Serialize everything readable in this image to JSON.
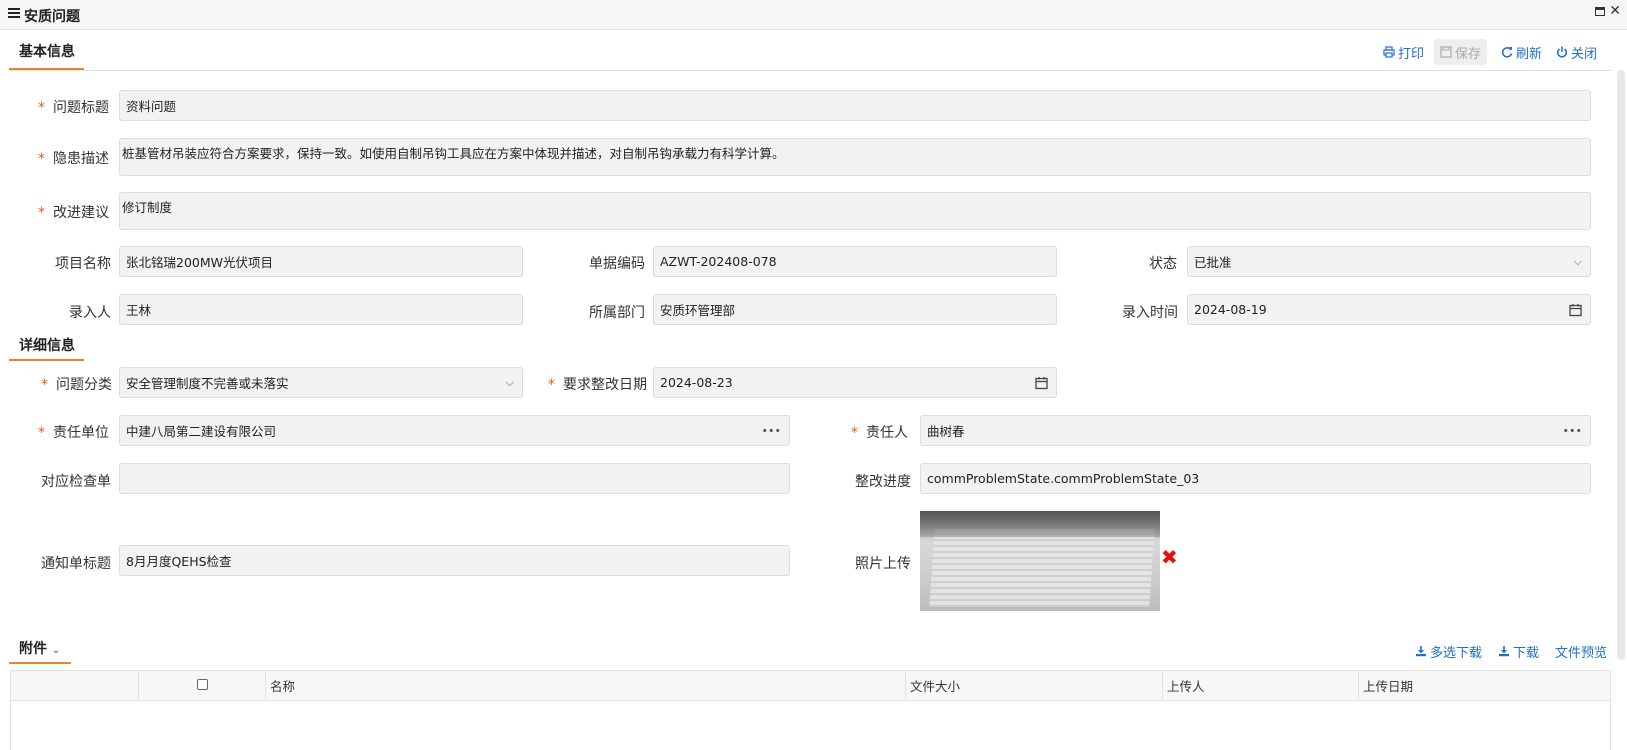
{
  "window": {
    "title": "安质问题"
  },
  "toolbar": {
    "print": "打印",
    "save": "保存",
    "refresh": "刷新",
    "close": "关闭"
  },
  "sections": {
    "basic": "基本信息",
    "detail": "详细信息",
    "attachments": "附件"
  },
  "basic": {
    "issue_title": {
      "label": "问题标题",
      "value": "资料问题"
    },
    "hazard_desc": {
      "label": "隐患描述",
      "value": "桩基管材吊装应符合方案要求，保持一致。如使用自制吊钩工具应在方案中体现并描述，对自制吊钩承载力有科学计算。"
    },
    "suggestion": {
      "label": "改进建议",
      "value": "修订制度"
    },
    "project": {
      "label": "项目名称",
      "value": "张北铭瑞200MW光伏项目"
    },
    "doc_code": {
      "label": "单据编码",
      "value": "AZWT-202408-078"
    },
    "status": {
      "label": "状态",
      "value": "已批准"
    },
    "entered_by": {
      "label": "录入人",
      "value": "王林"
    },
    "department": {
      "label": "所属部门",
      "value": "安质环管理部"
    },
    "entered_time": {
      "label": "录入时间",
      "value": "2024-08-19"
    }
  },
  "detail": {
    "category": {
      "label": "问题分类",
      "value": "安全管理制度不完善或未落实"
    },
    "deadline": {
      "label": "要求整改日期",
      "value": "2024-08-23"
    },
    "resp_unit": {
      "label": "责任单位",
      "value": "中建八局第二建设有限公司"
    },
    "resp_person": {
      "label": "责任人",
      "value": "曲树春"
    },
    "checklist": {
      "label": "对应检查单",
      "value": ""
    },
    "progress": {
      "label": "整改进度",
      "value": "commProblemState.commProblemState_03"
    },
    "notice_title": {
      "label": "通知单标题",
      "value": "8月月度QEHS检查"
    },
    "photo": {
      "label": "照片上传"
    }
  },
  "attachments": {
    "multi_download": "多选下载",
    "download": "下载",
    "preview": "文件预览",
    "columns": [
      "名称",
      "文件大小",
      "上传人",
      "上传日期"
    ]
  },
  "icons": [
    "menu-icon",
    "maximize-icon",
    "close-icon",
    "print-icon",
    "save-icon",
    "refresh-icon",
    "power-icon",
    "chevron-down-icon",
    "calendar-icon",
    "ellipsis-icon",
    "download-icon",
    "delete-icon"
  ],
  "colors": {
    "accent": "#e8862a",
    "link": "#1e6fd0",
    "required": "#e55a1c",
    "delete": "#e0140f"
  }
}
